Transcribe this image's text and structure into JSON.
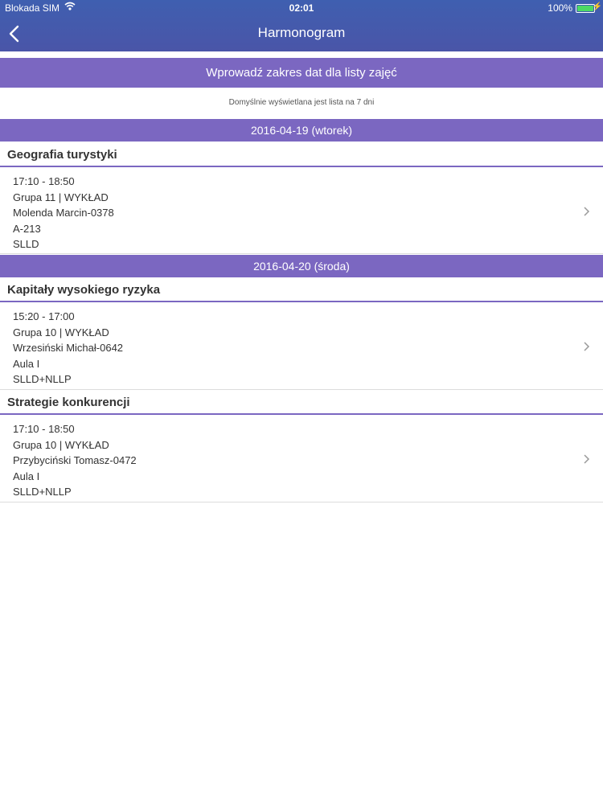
{
  "status_bar": {
    "carrier": "Blokada SIM",
    "time": "02:01",
    "battery": "100%"
  },
  "nav": {
    "title": "Harmonogram"
  },
  "date_range_button": "Wprowadź zakres dat dla listy zajęć",
  "hint": "Domyślnie wyświetlana jest lista na 7 dni",
  "days": [
    {
      "header": "2016-04-19 (wtorek)",
      "classes": [
        {
          "subject": "Geografia turystyki",
          "time": "17:10 - 18:50",
          "group": "Grupa 11 | WYKŁAD",
          "teacher": "Molenda Marcin-0378",
          "room": "A-213",
          "mode": "SLLD"
        }
      ]
    },
    {
      "header": "2016-04-20 (środa)",
      "classes": [
        {
          "subject": "Kapitały wysokiego ryzyka",
          "time": "15:20 - 17:00",
          "group": "Grupa 10 | WYKŁAD",
          "teacher": "Wrzesiński Michał-0642",
          "room": "Aula I",
          "mode": "SLLD+NLLP"
        },
        {
          "subject": "Strategie konkurencji",
          "time": "17:10 - 18:50",
          "group": "Grupa 10 | WYKŁAD",
          "teacher": "Przybyciński Tomasz-0472",
          "room": "Aula I",
          "mode": "SLLD+NLLP"
        }
      ]
    }
  ],
  "colors": {
    "nav_bar": "#4a55a8",
    "accent": "#7b67c1",
    "battery": "#4cd964"
  },
  "icons": {
    "back": "chevron-left-icon",
    "row": "chevron-right-icon",
    "wifi": "wifi-icon",
    "battery": "battery-icon"
  }
}
